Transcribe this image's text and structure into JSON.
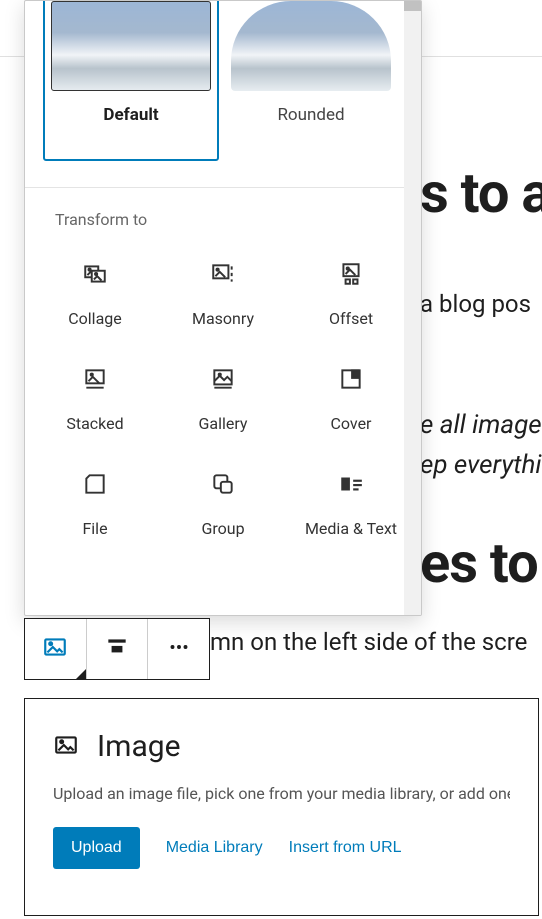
{
  "bg": {
    "h1a": "s to a",
    "p1": "a blog pos",
    "q1": "e all image",
    "q2": "ep everythi",
    "h1b": "es to y",
    "p2": "mn on the left side of the scre"
  },
  "styles": {
    "default_label": "Default",
    "rounded_label": "Rounded"
  },
  "transform": {
    "title": "Transform to",
    "items": [
      {
        "label": "Collage"
      },
      {
        "label": "Masonry"
      },
      {
        "label": "Offset"
      },
      {
        "label": "Stacked"
      },
      {
        "label": "Gallery"
      },
      {
        "label": "Cover"
      },
      {
        "label": "File"
      },
      {
        "label": "Group"
      },
      {
        "label": "Media & Text"
      }
    ]
  },
  "toolbar": {
    "image_btn": "Image block",
    "align_btn": "Align",
    "more_btn": "More options"
  },
  "imageBlock": {
    "title": "Image",
    "description": "Upload an image file, pick one from your media library, or add one w",
    "upload": "Upload",
    "media_library": "Media Library",
    "insert_url": "Insert from URL"
  }
}
